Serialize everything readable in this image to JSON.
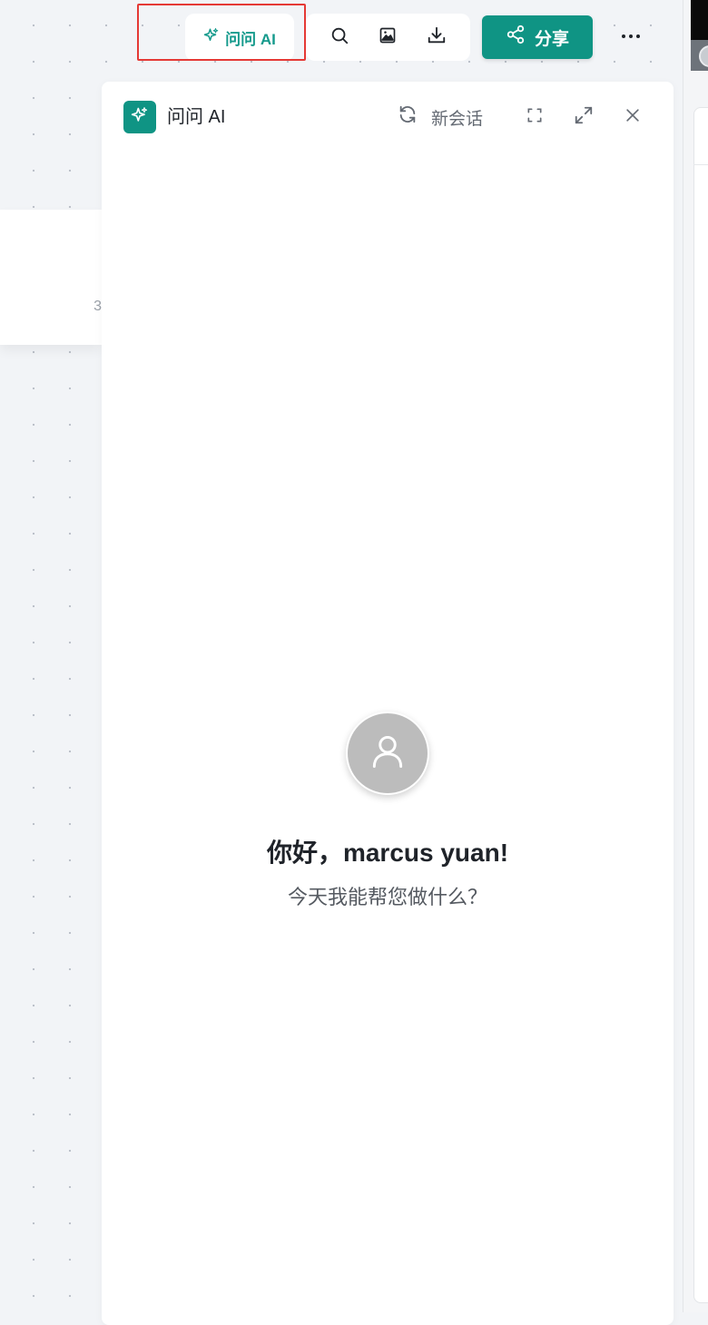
{
  "toolbar": {
    "ask_ai_label": "问问 AI",
    "share_label": "分享",
    "tools": [
      {
        "icon": "search-icon"
      },
      {
        "icon": "image-icon"
      },
      {
        "icon": "download-icon"
      }
    ],
    "more_icon": "more-icon"
  },
  "background": {
    "card_number": "3"
  },
  "ai_panel": {
    "title": "问问 AI",
    "new_chat_label": "新会话",
    "greeting": "你好，marcus yuan!",
    "subtitle": "今天我能帮您做什么？"
  },
  "colors": {
    "accent": "#0f9484",
    "ask_ai_text": "#159a8c",
    "highlight": "#e53935",
    "avatar": "#bcbcbc"
  }
}
